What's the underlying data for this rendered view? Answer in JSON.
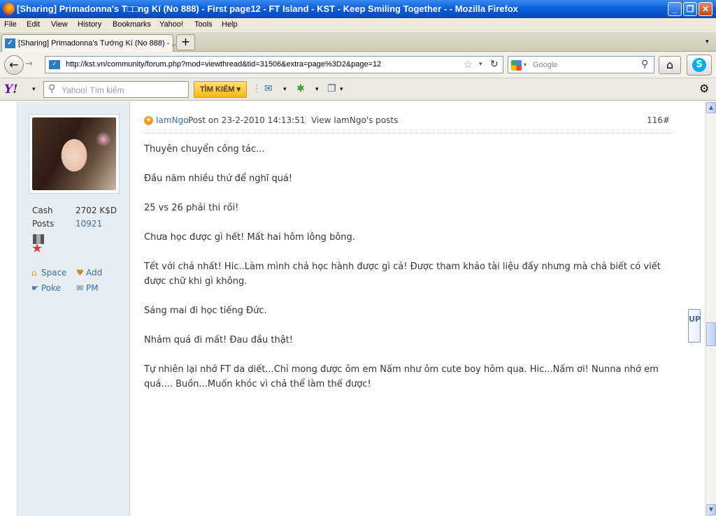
{
  "window": {
    "title": "[Sharing] Primadonna's T□□ng Kí (No 888) - First page12 - FT Island - KST - Keep Smiling Together - - Mozilla Firefox",
    "min": "_",
    "max": "❐",
    "close": "✕"
  },
  "menu": [
    "File",
    "Edit",
    "View",
    "History",
    "Bookmarks",
    "Yahoo!",
    "Tools",
    "Help"
  ],
  "tab": {
    "label": "[Sharing] Primadonna's Tướng Kí (No 888) - ...",
    "new_tab": "+"
  },
  "nav": {
    "url": "http://kst.vn/community/forum.php?mod=viewthread&tid=31506&extra=page%3D2&page=12",
    "search_placeholder": "Google"
  },
  "yahoo": {
    "logo": "Y!",
    "search_placeholder": "Yahoo! Tìm kiếm",
    "search_button": "TÌM KIẾM ▾"
  },
  "profile": {
    "cash_label": "Cash",
    "cash_value": "2702 K$D",
    "posts_label": "Posts",
    "posts_value": "10921",
    "links": {
      "space": "Space",
      "add": "Add",
      "poke": "Poke",
      "pm": "PM"
    }
  },
  "post": {
    "author": "IamNgo",
    "posted": "Post on 23-2-2010 14:13:51",
    "separator": "|",
    "view_posts": "View IamNgo's posts",
    "number": "116#",
    "paragraphs": [
      "Thuyên chuyển công tác...",
      "Đầu năm nhiều thứ để nghĩ quá!",
      "25 vs 26 phải thi rồi!",
      "Chưa học được gì hết! Mất hai hôm lông bông.",
      "Tết với chả nhất! Hic..Làm mình chả học hành được gì cả! Được tham khảo tài liệu đấy nhưng mà chả biết có viết được chữ khi gì không.",
      "Sáng mai đi học tiếng Đức.",
      "Nhảm quá đi mất! Đau đầu thật!",
      "Tự nhiên lại nhớ FT da diết...Chỉ mong được ôm em Nấm như ôm cute boy hôm qua. Hic...Nấm ơi! Nunna nhớ em quá.... Buồn...Muốn khóc vì chả thể làm thế được!"
    ]
  },
  "up_button": "UP"
}
